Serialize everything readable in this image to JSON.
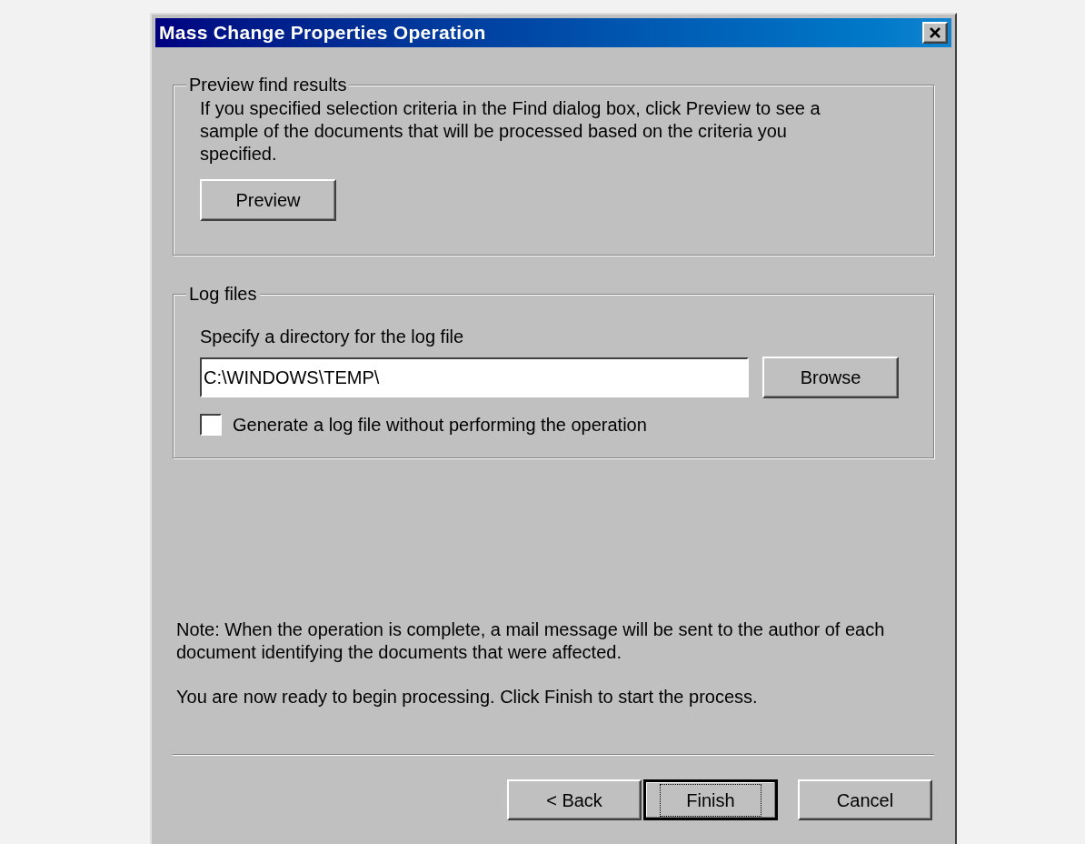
{
  "window": {
    "title": "Mass Change Properties Operation"
  },
  "preview_group": {
    "title": "Preview find results",
    "description": "If you specified selection criteria in the Find dialog box, click Preview to see a sample of the documents that will be processed based on the criteria you specified.",
    "button": "Preview"
  },
  "log_group": {
    "title": "Log files",
    "field_label": "Specify a directory for the log file",
    "field_value": "C:\\WINDOWS\\TEMP\\",
    "browse_button": "Browse",
    "checkbox": {
      "label": "Generate a log file without performing the operation",
      "checked": false
    }
  },
  "note": "Note: When the operation is complete, a mail message will be sent to the author of each document identifying the documents that were affected.",
  "ready_text": "You are now ready to begin processing. Click Finish to start the process.",
  "buttons": [
    {
      "label": "< Back",
      "focused": false
    },
    {
      "label": "Finish",
      "focused": true
    },
    {
      "label": "Cancel",
      "focused": false
    }
  ]
}
